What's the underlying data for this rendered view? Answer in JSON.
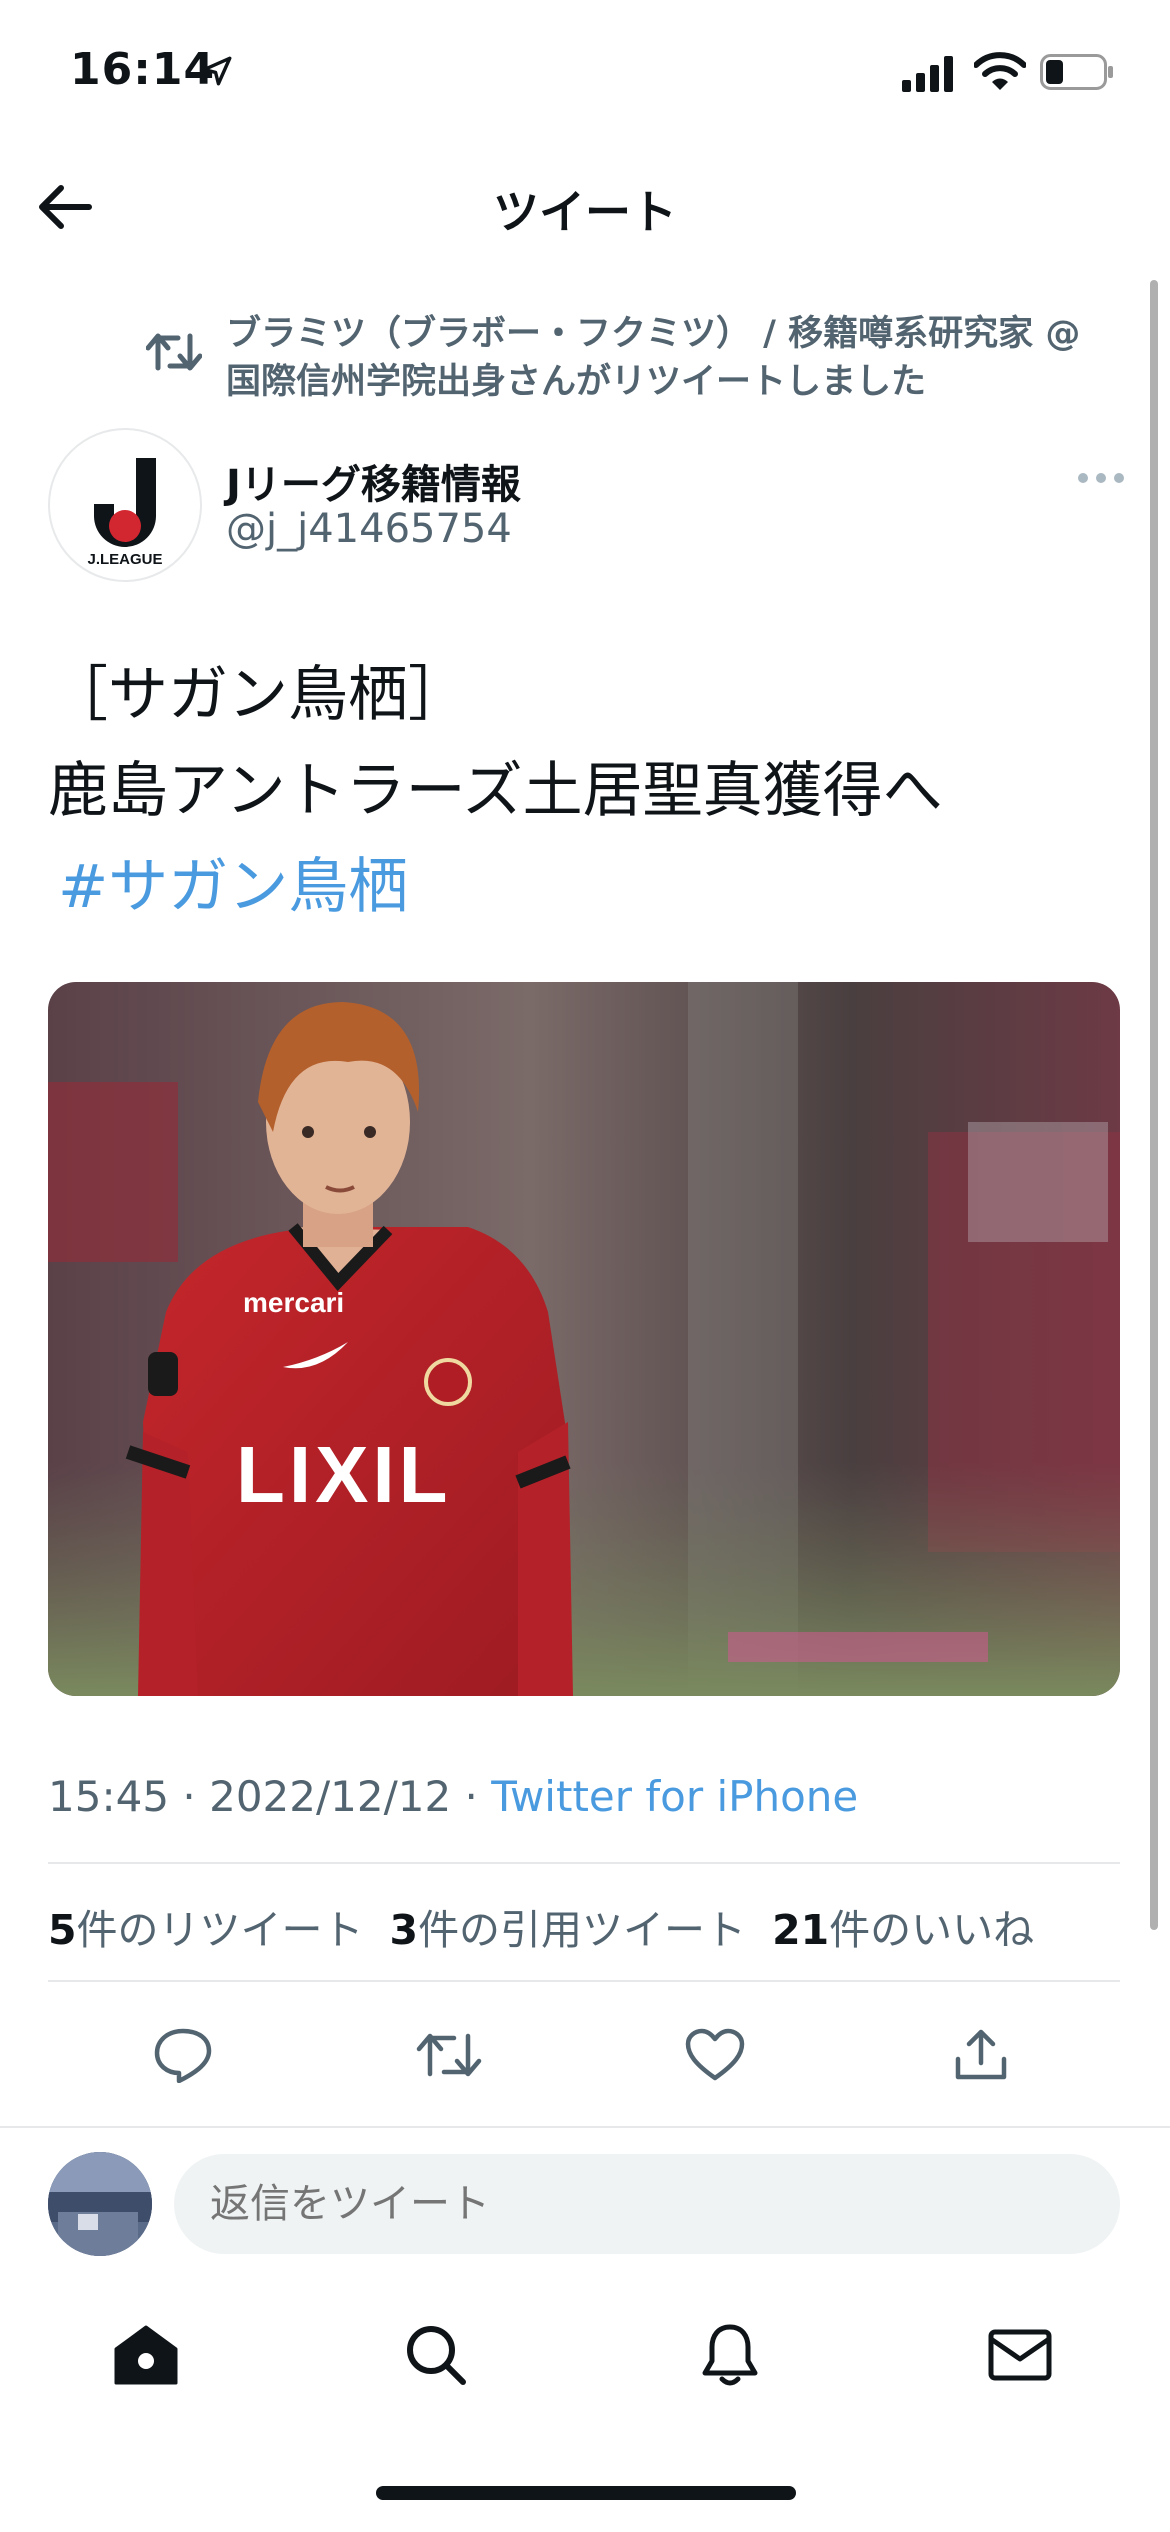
{
  "status_bar": {
    "time": "16:14",
    "battery_level": 0.3
  },
  "header": {
    "title": "ツイート"
  },
  "retweet_banner": {
    "text": "ブラミツ（ブラボー・フクミツ） / 移籍噂系研究家 @国際信州学院出身さんがリツイートしました"
  },
  "author": {
    "name": "Jリーグ移籍情報",
    "handle": "@j_j41465754",
    "avatar_logo_text": "J.LEAGUE"
  },
  "tweet": {
    "line1": "［サガン鳥栖］",
    "line2": "鹿島アントラーズ土居聖真獲得へ",
    "hashtag": "#サガン鳥栖",
    "photo_jersey_sponsor": "LIXIL",
    "photo_chest_sponsor": "mercari"
  },
  "meta": {
    "time": "15:45",
    "separator": " · ",
    "date": "2022/12/12",
    "source": "Twitter for iPhone"
  },
  "stats": {
    "retweets_count": "5",
    "retweets_label": "件のリツイート",
    "quotes_count": "3",
    "quotes_label": "件の引用ツイート",
    "likes_count": "21",
    "likes_label": "件のいいね"
  },
  "composer": {
    "placeholder": "返信をツイート"
  },
  "colors": {
    "link": "#4a9ae0",
    "secondary_text": "#536471",
    "primary_text": "#0f1419"
  }
}
